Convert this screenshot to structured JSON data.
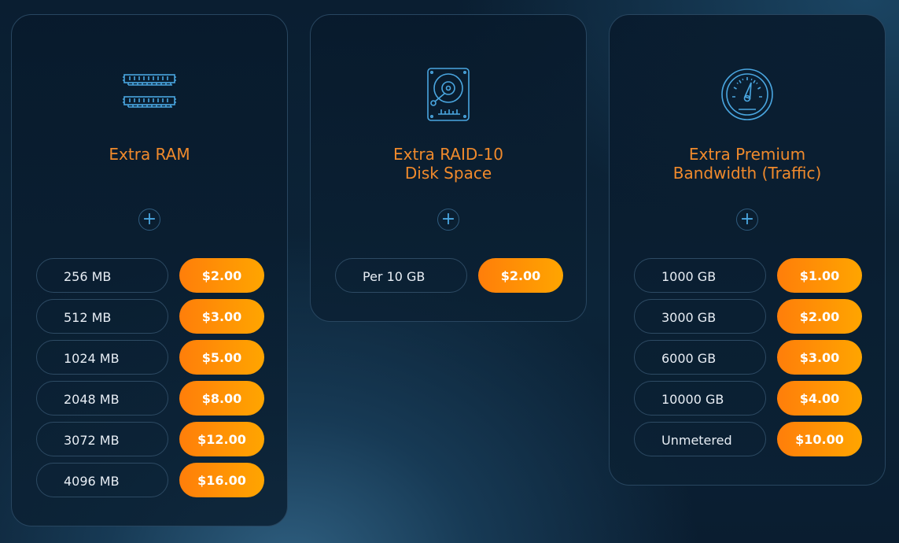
{
  "colors": {
    "accent": "#f08a2c",
    "icon": "#4aa6e0",
    "price_start": "#ff7e0a",
    "price_end": "#ffa500"
  },
  "cards": [
    {
      "icon": "ram-icon",
      "title": "Extra RAM",
      "rows": [
        {
          "label": "256 MB",
          "price": "$2.00"
        },
        {
          "label": "512 MB",
          "price": "$3.00"
        },
        {
          "label": "1024 MB",
          "price": "$5.00"
        },
        {
          "label": "2048 MB",
          "price": "$8.00"
        },
        {
          "label": "3072 MB",
          "price": "$12.00"
        },
        {
          "label": "4096 MB",
          "price": "$16.00"
        }
      ]
    },
    {
      "icon": "hard-disk-icon",
      "title": "Extra RAID-10\nDisk Space",
      "rows": [
        {
          "label": "Per 10 GB",
          "price": "$2.00"
        }
      ]
    },
    {
      "icon": "speedometer-icon",
      "title": "Extra Premium\nBandwidth (Traffic)",
      "rows": [
        {
          "label": "1000 GB",
          "price": "$1.00"
        },
        {
          "label": "3000 GB",
          "price": "$2.00"
        },
        {
          "label": "6000 GB",
          "price": "$3.00"
        },
        {
          "label": "10000 GB",
          "price": "$4.00"
        },
        {
          "label": "Unmetered",
          "price": "$10.00"
        }
      ]
    }
  ]
}
